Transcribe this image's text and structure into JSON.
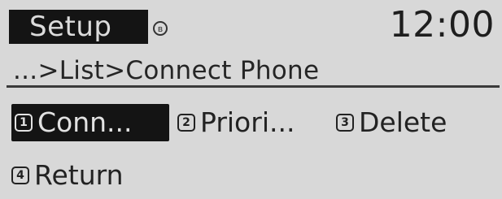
{
  "header": {
    "title": "Setup",
    "status_icon": "bluetooth-icon",
    "clock": "12:00"
  },
  "breadcrumb": "...>List>Connect Phone",
  "menu": {
    "items": [
      {
        "number": "1",
        "label": "Conn...",
        "selected": true
      },
      {
        "number": "2",
        "label": "Priori...",
        "selected": false
      },
      {
        "number": "3",
        "label": "Delete",
        "selected": false
      },
      {
        "number": "4",
        "label": "Return",
        "selected": false
      }
    ]
  },
  "colors": {
    "screen_background": "#d8d8d8",
    "highlight_background": "#141414",
    "highlight_text": "#e2e2e2",
    "text": "#222222"
  }
}
